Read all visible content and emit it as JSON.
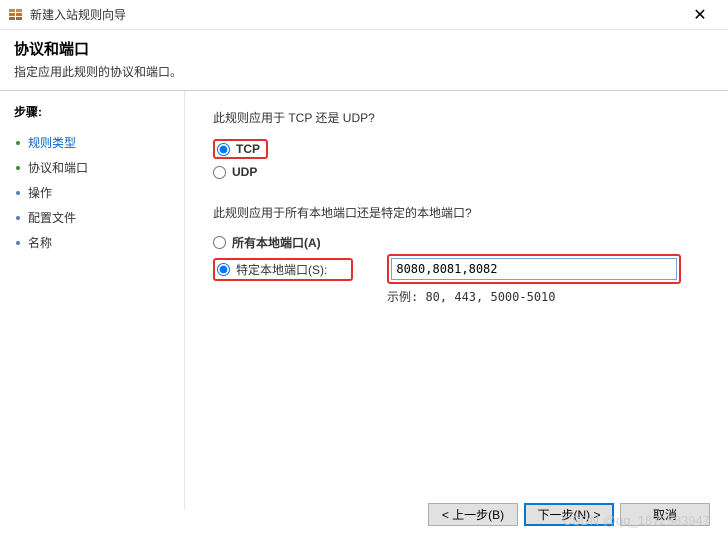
{
  "titlebar": {
    "title": "新建入站规则向导",
    "close": "✕"
  },
  "header": {
    "title": "协议和端口",
    "subtitle": "指定应用此规则的协议和端口。"
  },
  "sidebar": {
    "heading": "步骤:",
    "items": [
      {
        "label": "规则类型",
        "type": "link"
      },
      {
        "label": "协议和端口",
        "type": "normal"
      },
      {
        "label": "操作",
        "type": "normal"
      },
      {
        "label": "配置文件",
        "type": "normal"
      },
      {
        "label": "名称",
        "type": "normal"
      }
    ]
  },
  "main": {
    "q1": "此规则应用于 TCP 还是 UDP?",
    "tcp_label": "TCP",
    "udp_label": "UDP",
    "q2": "此规则应用于所有本地端口还是特定的本地端口?",
    "all_ports_label": "所有本地端口(A)",
    "specific_ports_label": "特定本地端口(S):",
    "port_value": "8080,8081,8082",
    "port_example": "示例: 80, 443, 5000-5010"
  },
  "footer": {
    "back": "< 上一步(B)",
    "next": "下一步(N) >",
    "cancel": "取消"
  },
  "watermark": "CSDN @qq_1872583947"
}
